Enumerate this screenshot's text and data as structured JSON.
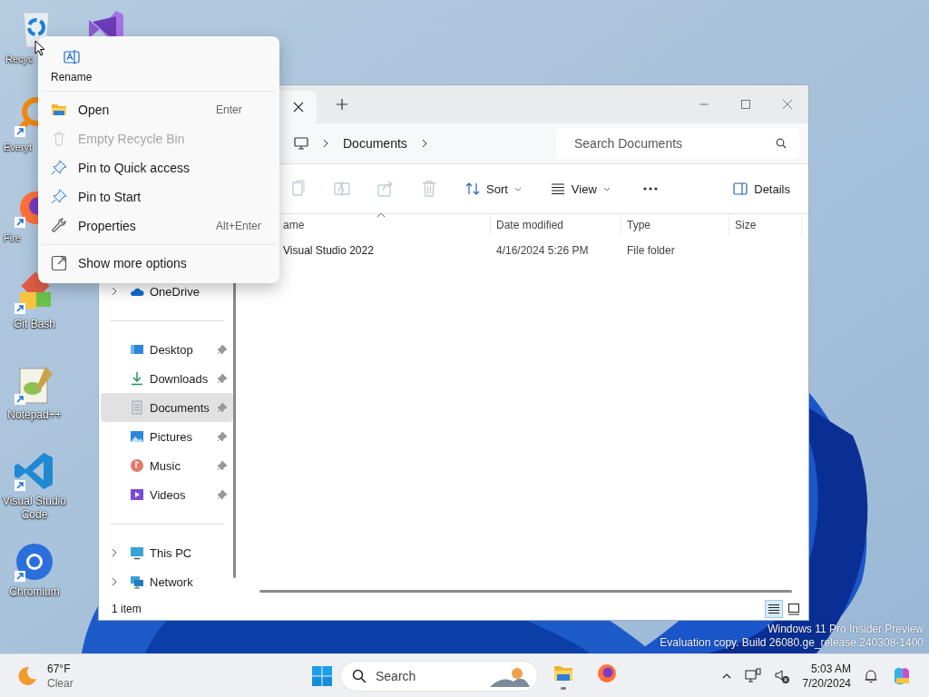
{
  "desktop_icons": [
    {
      "label": "Recyc",
      "kind": "recycle"
    },
    {
      "kind": "visualstudio"
    },
    {
      "label": "Everyt",
      "kind": "everything"
    },
    {
      "label": "Fire",
      "kind": "firefox"
    },
    {
      "label": "Git Bash",
      "kind": "git"
    },
    {
      "label": "Notepad++",
      "kind": "notepad"
    },
    {
      "label": "Visual Studio Code",
      "kind": "vscode"
    },
    {
      "label": "Chromium",
      "kind": "chromium"
    }
  ],
  "explorer": {
    "address": {
      "crumbs": [
        "Documents"
      ]
    },
    "search": {
      "placeholder": "Search Documents"
    },
    "toolbar": [
      {
        "kind": "copy",
        "disabled": true
      },
      {
        "kind": "rename",
        "disabled": true
      },
      {
        "kind": "share",
        "disabled": true
      },
      {
        "kind": "delete",
        "disabled": true
      },
      {
        "kind": "sort",
        "label": "Sort",
        "disabled": false
      },
      {
        "kind": "view",
        "label": "View",
        "disabled": false
      },
      {
        "kind": "more",
        "disabled": false
      }
    ],
    "details_button": "Details",
    "columns": [
      "ame",
      "Date modified",
      "Type",
      "Size"
    ],
    "rows": [
      {
        "name": "Visual Studio 2022",
        "date": "4/16/2024 5:26 PM",
        "type": "File folder",
        "selected": false
      }
    ],
    "sidebar": [
      {
        "items": [
          {
            "label": "OneDrive",
            "kind": "cloud",
            "expandable": true,
            "pinned": false,
            "selected": false
          }
        ]
      },
      {
        "items": [
          {
            "label": "Desktop",
            "kind": "desktop",
            "expandable": false,
            "pinned": true,
            "selected": false
          },
          {
            "label": "Downloads",
            "kind": "downloads",
            "expandable": false,
            "pinned": true,
            "selected": false
          },
          {
            "label": "Documents",
            "kind": "documents",
            "expandable": false,
            "pinned": true,
            "selected": true
          },
          {
            "label": "Pictures",
            "kind": "pictures",
            "expandable": false,
            "pinned": true,
            "selected": false
          },
          {
            "label": "Music",
            "kind": "music",
            "expandable": false,
            "pinned": true,
            "selected": false
          },
          {
            "label": "Videos",
            "kind": "videos",
            "expandable": false,
            "pinned": true,
            "selected": false
          }
        ]
      },
      {
        "items": [
          {
            "label": "This PC",
            "kind": "pc",
            "expandable": true,
            "pinned": false,
            "selected": false
          },
          {
            "label": "Network",
            "kind": "network",
            "expandable": true,
            "pinned": false,
            "selected": false
          }
        ]
      }
    ],
    "status": "1 item",
    "view_modes": [
      {
        "kind": "details",
        "selected": true
      },
      {
        "kind": "tiles",
        "selected": false
      }
    ]
  },
  "context_menu": {
    "top": [
      {
        "label": "Rename",
        "kind": "rename"
      }
    ],
    "sections": [
      {
        "items": [
          {
            "label": "Open",
            "shortcut": "Enter",
            "kind": "open",
            "disabled": false
          },
          {
            "label": "Empty Recycle Bin",
            "kind": "bin",
            "disabled": true
          },
          {
            "label": "Pin to Quick access",
            "kind": "pin",
            "disabled": false
          },
          {
            "label": "Pin to Start",
            "kind": "pin",
            "disabled": false
          },
          {
            "label": "Properties",
            "shortcut": "Alt+Enter",
            "kind": "wrench",
            "disabled": false
          }
        ]
      },
      {
        "items": [
          {
            "label": "Show more options",
            "kind": "more",
            "disabled": false
          }
        ]
      }
    ]
  },
  "watermark": [
    "Windows 11 Pro Insider Preview",
    "Evaluation copy. Build 26080.ge_release.240308-1400"
  ],
  "taskbar": {
    "weather": {
      "temperature": "67°F",
      "condition": "Clear"
    },
    "search": {
      "placeholder": "Search"
    },
    "apps": [
      {
        "kind": "explorer",
        "running": true
      },
      {
        "kind": "firefox",
        "running": false
      }
    ],
    "clock": {
      "time": "5:03 AM",
      "date": "7/20/2024"
    }
  }
}
